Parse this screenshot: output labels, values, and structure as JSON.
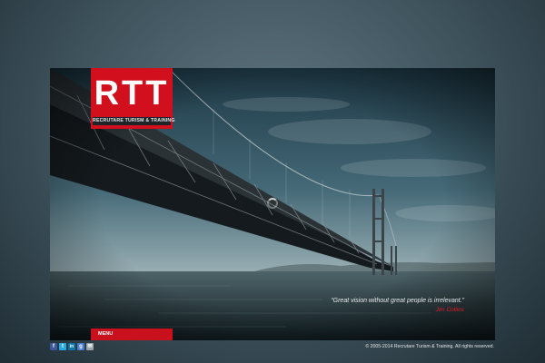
{
  "logo": {
    "mark": "RTT",
    "tagline": "Recrutare Turism & Training"
  },
  "quote": {
    "text": "“Great vision without great people is irrelevant.”",
    "author": "Jim Collins"
  },
  "menu": {
    "label": "Menu"
  },
  "footer": {
    "copyright": "© 2005-2014 Recrutare Turism & Training. All rights reserved.",
    "social": [
      {
        "name": "facebook-icon",
        "glyph": "f",
        "color": "#3b5998"
      },
      {
        "name": "twitter-icon",
        "glyph": "t",
        "color": "#2aa9e0"
      },
      {
        "name": "linkedin-icon",
        "glyph": "in",
        "color": "#0e76a8"
      },
      {
        "name": "google-plus-icon",
        "glyph": "g",
        "color": "#4a7bd2"
      },
      {
        "name": "email-icon",
        "glyph": "✉",
        "color": "#9aa3a8"
      }
    ]
  },
  "colors": {
    "accent": "#d10f1d"
  }
}
